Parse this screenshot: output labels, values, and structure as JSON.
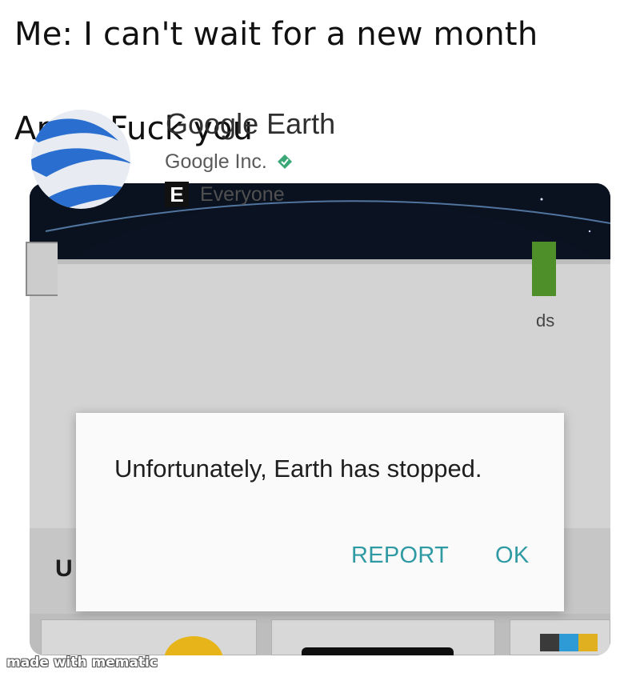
{
  "caption": {
    "line1": "Me: I can't wait for a new month",
    "line2": "April: Fuck you"
  },
  "app": {
    "title": "Google Earth",
    "developer": "Google Inc.",
    "content_rating_letter": "E",
    "content_rating": "Everyone",
    "downloads_fragment": "ds",
    "section_letter": "U"
  },
  "dialog": {
    "message": "Unfortunately, Earth has stopped.",
    "report_label": "REPORT",
    "ok_label": "OK"
  },
  "watermark": "made with mematic",
  "colors": {
    "dialog_button": "#2f9aa3",
    "install_button": "#4f8f2a",
    "icon_blue": "#2a6fd0",
    "verified": "#3aa876"
  },
  "icons": [
    "google-earth-logo-icon",
    "verified-developer-icon",
    "esrb-everyone-icon"
  ]
}
